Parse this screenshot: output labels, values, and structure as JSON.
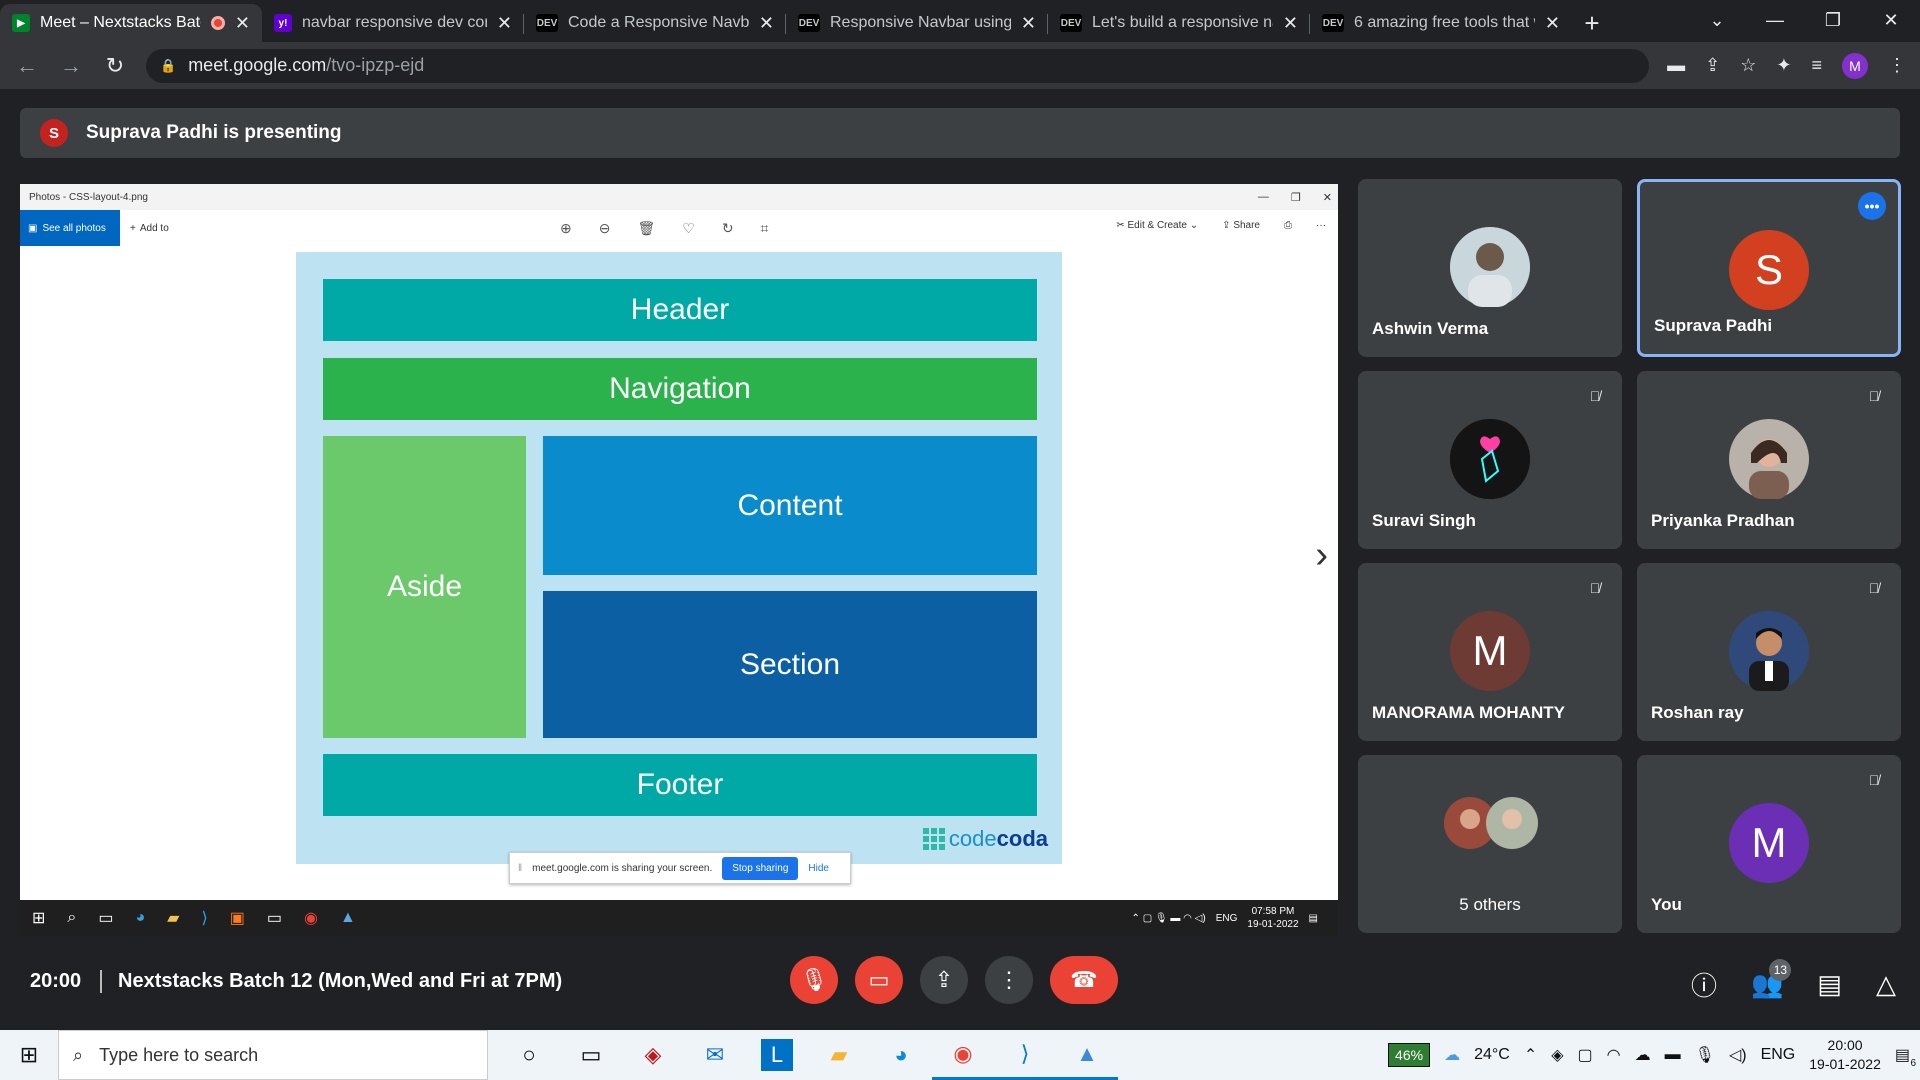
{
  "browser": {
    "tabs": [
      {
        "favicon": "meet-icon",
        "label": "Meet – Nextstacks Batc",
        "active": true,
        "recording": true
      },
      {
        "favicon": "yahoo-icon",
        "label": "navbar responsive dev com",
        "active": false
      },
      {
        "favicon": "dev-icon",
        "label": "Code a Responsive Navbar",
        "active": false
      },
      {
        "favicon": "dev-icon",
        "label": "Responsive Navbar using H",
        "active": false
      },
      {
        "favicon": "dev-icon",
        "label": "Let's build a responsive nav",
        "active": false
      },
      {
        "favicon": "dev-icon",
        "label": "6 amazing free tools that w",
        "active": false
      }
    ],
    "url_host": "meet.google.com",
    "url_path": "/tvo-ipzp-ejd",
    "profile_initial": "M",
    "dev_badge": "DEV"
  },
  "presenting": {
    "avatar_initial": "S",
    "text": "Suprava Padhi is presenting"
  },
  "shared_screen": {
    "window_title": "Photos - CSS-layout-4.png",
    "see_all": "See all photos",
    "add_to": "Add to",
    "edit_create": "Edit & Create",
    "share": "Share",
    "layout": {
      "header": "Header",
      "navigation": "Navigation",
      "aside": "Aside",
      "content": "Content",
      "section": "Section",
      "footer": "Footer"
    },
    "logo_code": "code",
    "logo_coda": "coda",
    "share_notice": "meet.google.com is sharing your screen.",
    "stop_sharing": "Stop sharing",
    "hide": "Hide",
    "inner_lang": "ENG",
    "inner_time": "07:58 PM",
    "inner_date": "19-01-2022",
    "colors": {
      "header": "#00a9a5",
      "navigation": "#2bb24c",
      "aside": "#6cc96b",
      "content": "#0a8ccc",
      "section": "#0d5fa3",
      "footer": "#00a9a5"
    }
  },
  "participants": [
    {
      "name": "Ashwin Verma",
      "avatar": "photo",
      "muted": false
    },
    {
      "name": "Suprava Padhi",
      "avatar": "S",
      "avatar_color": "#d2401f",
      "muted": false,
      "highlighted": true
    },
    {
      "name": "Suravi Singh",
      "avatar": "photo",
      "muted": true
    },
    {
      "name": "Priyanka Pradhan",
      "avatar": "photo",
      "muted": true
    },
    {
      "name": "MANORAMA MOHANTY",
      "avatar": "M",
      "avatar_color": "#6d3b34",
      "muted": true
    },
    {
      "name": "Roshan ray",
      "avatar": "photo",
      "muted": true
    },
    {
      "name": "5 others",
      "avatar": "group",
      "muted": false
    },
    {
      "name": "You",
      "avatar": "M",
      "avatar_color": "#6a2fb4",
      "muted": true
    }
  ],
  "meeting": {
    "time": "20:00",
    "title": "Nextstacks Batch 12 (Mon,Wed and Fri at 7PM)",
    "people_count": "13"
  },
  "windows": {
    "search_placeholder": "Type here to search",
    "battery": "46%",
    "weather": "24°C",
    "lang": "ENG",
    "time": "20:00",
    "date": "19-01-2022",
    "notif_count": "6"
  }
}
